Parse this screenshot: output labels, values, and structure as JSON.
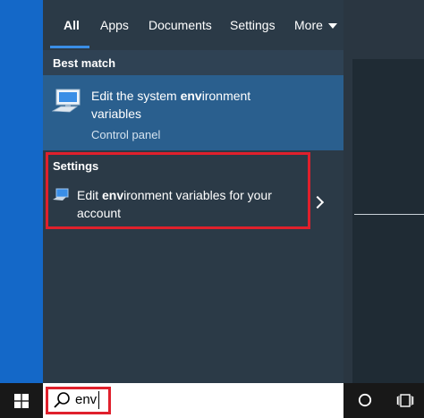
{
  "tabs": [
    {
      "label": "All",
      "active": true
    },
    {
      "label": "Apps"
    },
    {
      "label": "Documents"
    },
    {
      "label": "Settings"
    },
    {
      "label": "More"
    }
  ],
  "best_match": {
    "header": "Best match",
    "item": {
      "title_pre": "Edit the system ",
      "title_bold": "env",
      "title_post": "ironment",
      "title_line2": "variables",
      "subtitle": "Control panel",
      "icon": "system-monitor-icon"
    }
  },
  "settings_section": {
    "header": "Settings",
    "item": {
      "title_pre": "Edit ",
      "title_bold": "env",
      "title_post": "ironment variables for your",
      "title_line2": "account",
      "icon": "monitor-settings-icon"
    }
  },
  "search": {
    "value": "env",
    "icon": "search-icon"
  },
  "taskbar": {
    "start_icon": "windows-logo-icon",
    "cortana_icon": "circle-icon",
    "task_view_icon": "task-view-icon"
  },
  "colors": {
    "accent": "#3a8ee6",
    "highlight_box": "#e0202c",
    "panel_bg": "#2b3a47",
    "selected_bg": "#2a5f8e"
  }
}
